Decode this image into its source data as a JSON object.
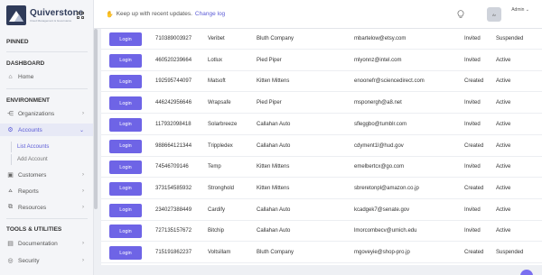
{
  "brand": {
    "name": "Quiverstone",
    "sub": "Cloud Management & Governance"
  },
  "topbar": {
    "notice": "Keep up with recent updates.",
    "changelog": "Change log",
    "avatar_text": "Ar",
    "user_label": "Admin"
  },
  "sidebar": {
    "pinned": "PINNED",
    "dashboard": "DASHBOARD",
    "home": "Home",
    "environment": "ENVIRONMENT",
    "organizations": "Organizations",
    "accounts": "Accounts",
    "list_accounts": "List Accounts",
    "add_account": "Add Account",
    "customers": "Customers",
    "reports": "Reports",
    "resources": "Resources",
    "tools": "TOOLS & UTILITIES",
    "documentation": "Documentation",
    "security": "Security"
  },
  "table": {
    "login_label": "Login",
    "rows": [
      {
        "id": "710389003927",
        "name": "Veribet",
        "company": "Bluth Company",
        "email": "mbartelow@etsy.com",
        "invite": "Invited",
        "status": "Suspended"
      },
      {
        "id": "460520239664",
        "name": "Lotlux",
        "company": "Pied Piper",
        "email": "mlyonnz@intel.com",
        "invite": "Invited",
        "status": "Active"
      },
      {
        "id": "192595744097",
        "name": "Matsoft",
        "company": "Kitten Mittens",
        "email": "enoonefr@sciencedirect.com",
        "invite": "Created",
        "status": "Active"
      },
      {
        "id": "446242956646",
        "name": "Wrapsafe",
        "company": "Pied Piper",
        "email": "msponergh@a8.net",
        "invite": "Invited",
        "status": "Active"
      },
      {
        "id": "117932098418",
        "name": "Solarbreeze",
        "company": "Callahan Auto",
        "email": "sfleggbo@tumblr.com",
        "invite": "Invited",
        "status": "Active"
      },
      {
        "id": "988664121344",
        "name": "Trippledex",
        "company": "Callahan Auto",
        "email": "cdyment1l@hud.gov",
        "invite": "Created",
        "status": "Active"
      },
      {
        "id": "74546709146",
        "name": "Temp",
        "company": "Kitten Mittens",
        "email": "emelbertcx@go.com",
        "invite": "Invited",
        "status": "Active"
      },
      {
        "id": "373154585932",
        "name": "Stronghold",
        "company": "Kitten Mittens",
        "email": "sbreretonpl@amazon.co.jp",
        "invite": "Created",
        "status": "Active"
      },
      {
        "id": "234027388449",
        "name": "Cardify",
        "company": "Callahan Auto",
        "email": "kcadgek7@senate.gov",
        "invite": "Invited",
        "status": "Active"
      },
      {
        "id": "727135157672",
        "name": "Bitchip",
        "company": "Callahan Auto",
        "email": "lmorcombecv@umich.edu",
        "invite": "Invited",
        "status": "Active"
      },
      {
        "id": "715191862237",
        "name": "Voltsillam",
        "company": "Bluth Company",
        "email": "mgoveyie@shop-pro.jp",
        "invite": "Created",
        "status": "Suspended"
      }
    ]
  },
  "colors": {
    "accent": "#6e64e6",
    "brand": "#2f3b59"
  }
}
